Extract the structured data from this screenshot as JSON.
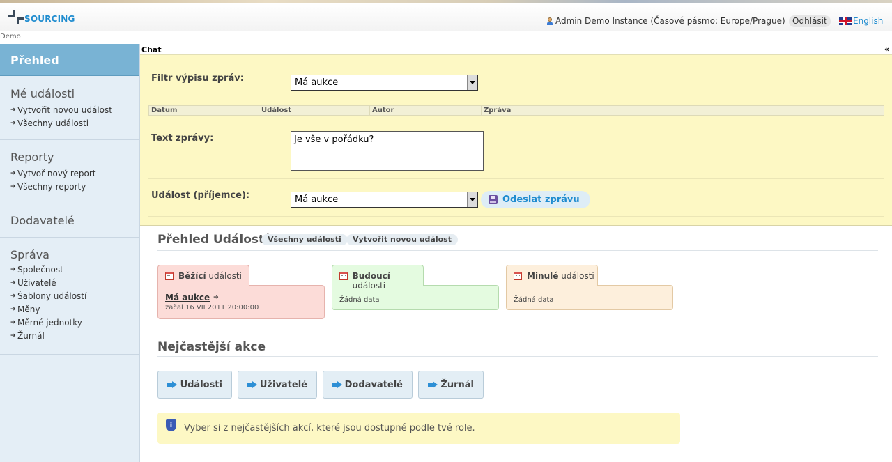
{
  "header": {
    "logo_text": "SOURCING",
    "user_text": "Admin Demo Instance (Časové pásmo: Europe/Prague)",
    "logout_label": "Odhlásit",
    "language_label": "English",
    "instance_label": "Demo"
  },
  "sidebar": {
    "active": "Přehled",
    "sections": [
      {
        "title": "Mé události",
        "links": [
          "Vytvořit novou událost",
          "Všechny události"
        ]
      },
      {
        "title": "Reporty",
        "links": [
          "Vytvoř nový report",
          "Všechny reporty"
        ]
      },
      {
        "title": "Dodavatelé",
        "links": []
      },
      {
        "title": "Správa",
        "links": [
          "Společnost",
          "Uživatelé",
          "Šablony událostí",
          "Měny",
          "Měrné jednotky",
          "Žurnál"
        ]
      }
    ]
  },
  "chat": {
    "title": "Chat",
    "collapse": "«",
    "filter_label": "Filtr výpisu zpráv:",
    "filter_value": "Má aukce",
    "columns": [
      "Datum",
      "Událost",
      "Autor",
      "Zpráva"
    ],
    "text_label": "Text zprávy:",
    "text_value": "Je vše v pořádku?",
    "recipient_label": "Událost (příjemce):",
    "recipient_value": "Má aukce",
    "send_label": "Odeslat zprávu"
  },
  "overview": {
    "title": "Přehled Událostí",
    "pill_all": "Všechny události",
    "pill_new": "Vytvořit novou událost",
    "running": {
      "bold": "Běžící",
      "rest": " události",
      "event_name": "Má aukce",
      "event_arrow": "➔",
      "started": "začal 16 VII 2011 20:00:00"
    },
    "future": {
      "bold": "Budoucí",
      "rest": " události",
      "empty": "Žádná data"
    },
    "past": {
      "bold": "Minulé",
      "rest": " události",
      "empty": "Žádná data"
    }
  },
  "actions": {
    "title": "Nejčastější akce",
    "buttons": [
      "Události",
      "Uživatelé",
      "Dodavatelé",
      "Žurnál"
    ],
    "info": "Vyber si z nejčastějších akcí, které jsou dostupné podle tvé role."
  },
  "colors": {
    "accent": "#1f8ccf",
    "sidebar_active": "#79b3d4",
    "chat_bg": "#fdf8c4",
    "running_bg": "#fcdcd8",
    "future_bg": "#e4fbe0",
    "past_bg": "#fdefdc"
  }
}
